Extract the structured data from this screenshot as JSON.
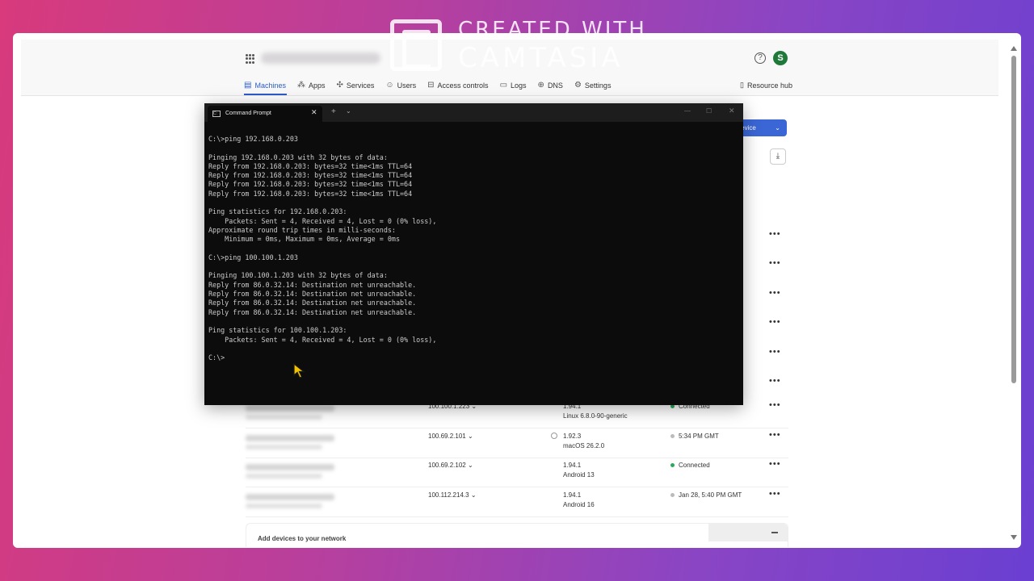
{
  "watermark": {
    "line1": "CREATED WITH",
    "line2": "CAMTASIA"
  },
  "header": {
    "avatar_initial": "S",
    "nav": [
      {
        "label": "Machines",
        "icon": "machines-icon",
        "glyph": "▤"
      },
      {
        "label": "Apps",
        "icon": "apps-icon",
        "glyph": "⁂"
      },
      {
        "label": "Services",
        "icon": "services-icon",
        "glyph": "✣"
      },
      {
        "label": "Users",
        "icon": "users-icon",
        "glyph": "☺"
      },
      {
        "label": "Access controls",
        "icon": "lock-icon",
        "glyph": "⊟"
      },
      {
        "label": "Logs",
        "icon": "logs-icon",
        "glyph": "▭"
      },
      {
        "label": "DNS",
        "icon": "globe-icon",
        "glyph": "⊕"
      },
      {
        "label": "Settings",
        "icon": "gear-icon",
        "glyph": "⚙"
      }
    ],
    "resource_hub": "Resource hub",
    "help_glyph": "?"
  },
  "page": {
    "add_device_label": "d device",
    "machines": [
      {
        "ip": "100.100.1.223",
        "version": "1.94.1",
        "os": "Linux 6.8.0-90-generic",
        "status": "Connected",
        "status_color": "#2da85b"
      },
      {
        "ip": "100.69.2.101",
        "version": "1.92.3",
        "os": "macOS 26.2.0",
        "status": "5:34 PM GMT",
        "status_color": "#bbbbbb"
      },
      {
        "ip": "100.69.2.102",
        "version": "1.94.1",
        "os": "Android 13",
        "status": "Connected",
        "status_color": "#2da85b"
      },
      {
        "ip": "100.112.214.3",
        "version": "1.94.1",
        "os": "Android 16",
        "status": "Jan 28, 5:40 PM GMT",
        "status_color": "#bbbbbb"
      }
    ],
    "more_glyph": "•••",
    "footer_text": "Add devices to your network"
  },
  "terminal": {
    "tab_title": "Command Prompt",
    "lines": [
      "C:\\>ping 192.168.0.203",
      "",
      "Pinging 192.168.0.203 with 32 bytes of data:",
      "Reply from 192.168.0.203: bytes=32 time<1ms TTL=64",
      "Reply from 192.168.0.203: bytes=32 time<1ms TTL=64",
      "Reply from 192.168.0.203: bytes=32 time<1ms TTL=64",
      "Reply from 192.168.0.203: bytes=32 time<1ms TTL=64",
      "",
      "Ping statistics for 192.168.0.203:",
      "    Packets: Sent = 4, Received = 4, Lost = 0 (0% loss),",
      "Approximate round trip times in milli-seconds:",
      "    Minimum = 0ms, Maximum = 0ms, Average = 0ms",
      "",
      "C:\\>ping 100.100.1.203",
      "",
      "Pinging 100.100.1.203 with 32 bytes of data:",
      "Reply from 86.0.32.14: Destination net unreachable.",
      "Reply from 86.0.32.14: Destination net unreachable.",
      "Reply from 86.0.32.14: Destination net unreachable.",
      "Reply from 86.0.32.14: Destination net unreachable.",
      "",
      "Ping statistics for 100.100.1.203:",
      "    Packets: Sent = 4, Received = 4, Lost = 0 (0% loss),",
      "",
      "C:\\>"
    ]
  },
  "colors": {
    "accent": "#2b5cc8",
    "terminal_bg": "#0c0c0c",
    "terminal_fg": "#cccccc",
    "connected": "#2da85b",
    "cursor": "#f2c200"
  }
}
